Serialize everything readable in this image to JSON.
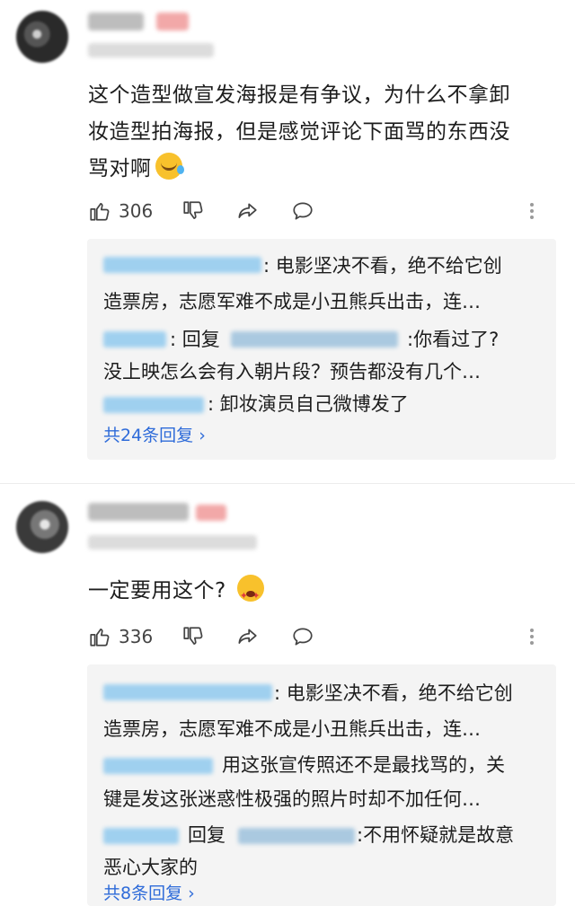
{
  "comments": [
    {
      "text_lines": [
        "这个造型做宣发海报是有争议，为什么不拿卸",
        "妆造型拍海报，但是感觉评论下面骂的东西没",
        "骂对啊"
      ],
      "emoji": "crying-laughing-emoji",
      "likes": "306",
      "replies": [
        {
          "text": ": 电影坚决不看，绝不给它创",
          "text2": "造票房，志愿军难不成是小丑熊兵出击，连…"
        },
        {
          "prefix": ": 回复",
          "text": ":你看过了?",
          "text2": "没上映怎么会有入朝片段？预告都没有几个…"
        },
        {
          "text": ": 卸妆演员自己微博发了"
        }
      ],
      "more_replies": "共24条回复 ›"
    },
    {
      "text_lines": [
        "一定要用这个?"
      ],
      "emoji": "starry-eyed-emoji",
      "likes": "336",
      "replies": [
        {
          "text": ": 电影坚决不看，绝不给它创",
          "text2": "造票房，志愿军难不成是小丑熊兵出击，连…"
        },
        {
          "text": "用这张宣传照还不是最找骂的，关",
          "text2": "键是发这张迷惑性极强的照片时却不加任何…"
        },
        {
          "prefix": "回复",
          "text": ":不用怀疑就是故意",
          "text2": "恶心大家的"
        }
      ],
      "more_replies": "共8条回复 ›"
    }
  ],
  "colors": {
    "link": "#2e6bd9",
    "reply_bg": "#f4f4f4",
    "text": "#1d1d1d"
  }
}
